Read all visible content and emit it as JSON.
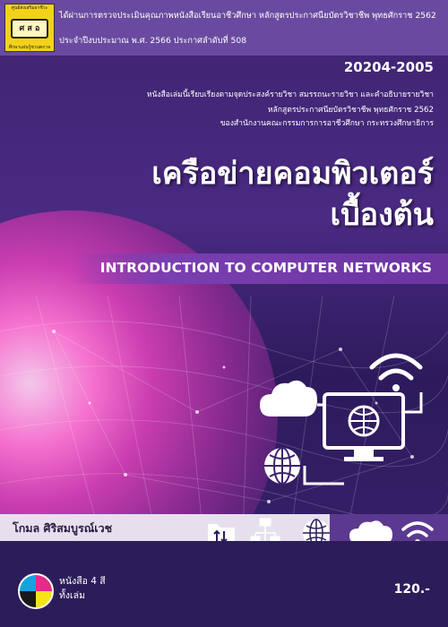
{
  "publisher": {
    "logo_top": "ศูนย์ส่งเสริมอาชีวะ",
    "logo_mid": "ศ ส อ",
    "logo_bottom": "ศึกษาแผ่นรู้ชวนตกาล"
  },
  "approval": {
    "line1": "ได้ผ่านการตรวจประเมินคุณภาพหนังสือเรียนอาชีวศึกษา หลักสูตรประกาศนียบัตรวิชาชีพ พุทธศักราช 2562",
    "line2": "ประจำปีงบประมาณ พ.ศ. 2566 ประกาศลำดับที่ 508"
  },
  "course_code": "20204-2005",
  "description": {
    "line1": "หนังสือเล่มนี้เรียบเรียงตามจุดประสงค์รายวิชา สมรรถนะรายวิชา และคำอธิบายรายวิชา",
    "line2": "หลักสูตรประกาศนียบัตรวิชาชีพ พุทธศักราช 2562",
    "line3": "ของสำนักงานคณะกรรมการการอาชีวศึกษา กระทรวงศึกษาธิการ"
  },
  "title": {
    "line1": "เครือข่ายคอมพิวเตอร์",
    "line2": "เบื้องต้น",
    "english": "INTRODUCTION TO COMPUTER NETWORKS"
  },
  "author": "โกมล ศิริสมบูรณ์เวช",
  "color_note": {
    "line1": "หนังสือ 4 สี",
    "line2": "ทั้งเล่ม"
  },
  "price": "120.-",
  "colors": {
    "background": "#3d2470",
    "accent_purple": "#7a3fb0",
    "globe_pink": "#ff76d4",
    "logo_yellow": "#f3d21a"
  },
  "icons": [
    "wifi-icon",
    "cloud-icon",
    "monitor-globe-icon",
    "globe-icon",
    "folder-transfer-icon",
    "network-icon",
    "globe-icon",
    "cloud-icon",
    "wifi-icon"
  ]
}
